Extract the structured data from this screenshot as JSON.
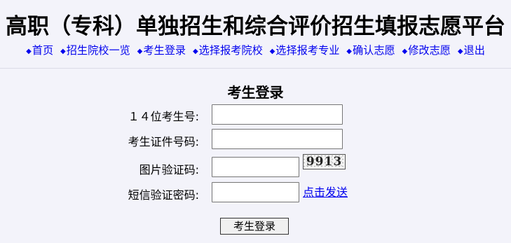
{
  "site": {
    "title": "高职（专科）单独招生和综合评价招生填报志愿平台"
  },
  "nav": {
    "items": [
      {
        "label": "首页"
      },
      {
        "label": "招生院校一览"
      },
      {
        "label": "考生登录"
      },
      {
        "label": "选择报考院校"
      },
      {
        "label": "选择报考专业"
      },
      {
        "label": "确认志愿"
      },
      {
        "label": "修改志愿"
      },
      {
        "label": "退出"
      }
    ],
    "bullet": "◆"
  },
  "form": {
    "title": "考生登录",
    "exam_number": {
      "label": "１４位考生号:",
      "value": ""
    },
    "id_number": {
      "label": "考生证件号码:",
      "value": ""
    },
    "captcha": {
      "label": "图片验证码:",
      "value": "",
      "image_text": "9913"
    },
    "sms_code": {
      "label": "短信验证密码:",
      "value": "",
      "send_link": "点击发送"
    },
    "submit_label": "考生登录"
  },
  "colors": {
    "background": "#f3f3fa",
    "link": "#0000ee"
  }
}
